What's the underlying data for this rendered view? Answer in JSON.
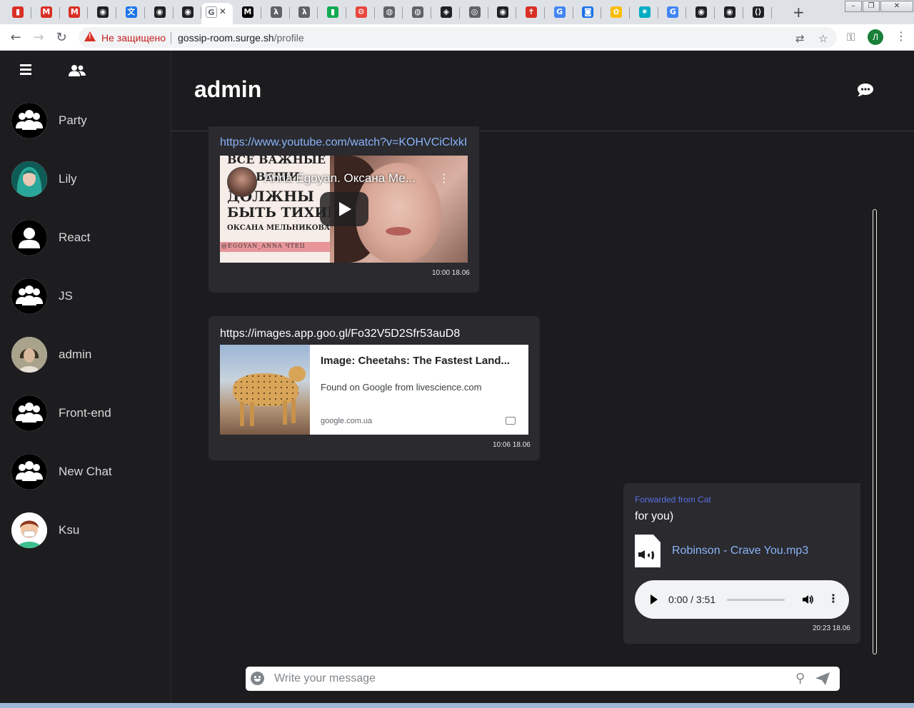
{
  "browser": {
    "tabs": [
      {
        "icon": "thermometer-icon",
        "color": "#d93025"
      },
      {
        "icon": "gmail-icon",
        "color": "#d93025"
      },
      {
        "icon": "gmail-icon",
        "color": "#d93025"
      },
      {
        "icon": "github-icon",
        "color": "#202124"
      },
      {
        "icon": "translate-icon",
        "color": "#1a73e8"
      },
      {
        "icon": "github-icon",
        "color": "#202124"
      },
      {
        "icon": "github-icon",
        "color": "#202124"
      },
      {
        "icon": "page-icon",
        "color": "#5f6368",
        "active": true
      },
      {
        "icon": "medium-icon",
        "color": "#000000"
      },
      {
        "icon": "lambda-icon",
        "color": "#5f6368"
      },
      {
        "icon": "lambda-icon",
        "color": "#5f6368"
      },
      {
        "icon": "mongodb-icon",
        "color": "#13aa52"
      },
      {
        "icon": "gear-icon",
        "color": "#e8453c"
      },
      {
        "icon": "globe-icon",
        "color": "#5f6368"
      },
      {
        "icon": "globe-icon",
        "color": "#5f6368"
      },
      {
        "icon": "cube-icon",
        "color": "#202124"
      },
      {
        "icon": "circle-icon",
        "color": "#5f6368"
      },
      {
        "icon": "github-icon",
        "color": "#202124"
      },
      {
        "icon": "figure-icon",
        "color": "#d93025"
      },
      {
        "icon": "google-icon",
        "color": "#4285f4"
      },
      {
        "icon": "app-icon",
        "color": "#1a73e8"
      },
      {
        "icon": "photos-icon",
        "color": "#fbbc04"
      },
      {
        "icon": "star-burst-icon",
        "color": "#00acc1"
      },
      {
        "icon": "google-icon",
        "color": "#4285f4"
      },
      {
        "icon": "github-icon",
        "color": "#202124"
      },
      {
        "icon": "github-icon",
        "color": "#202124"
      },
      {
        "icon": "code-icon",
        "color": "#202124"
      }
    ],
    "active_tab_letter": "G",
    "insecure_label": "Не защищено",
    "url_host": "gossip-room.surge.sh",
    "url_path": "/profile",
    "profile_initial": "Л"
  },
  "sidebar": {
    "chats": [
      {
        "name": "Party",
        "avatar": "group-icon"
      },
      {
        "name": "Lily",
        "avatar": "photo-avatar"
      },
      {
        "name": "React",
        "avatar": "user-icon"
      },
      {
        "name": "JS",
        "avatar": "group-icon"
      },
      {
        "name": "admin",
        "avatar": "photo-avatar"
      },
      {
        "name": "Front-end",
        "avatar": "group-icon"
      },
      {
        "name": "New Chat",
        "avatar": "group-icon"
      },
      {
        "name": "Ksu",
        "avatar": "cartoon-avatar"
      }
    ]
  },
  "main": {
    "title": "admin",
    "messages": [
      {
        "link": "https://www.youtube.com/watch?v=KOHVCiClxkI",
        "video_title": "Anna Egoyan. Оксана Ме...",
        "thumb_lines": [
          "ВСЕ ВАЖНЫЕ",
          "ВЕЩИ",
          "ДОЛЖНЫ",
          "БЫТЬ ТИХИМИ",
          "ОКСАНА МЕЛЬНИКОВА"
        ],
        "thumb_tag": "@EGOYAN_ANNA    ЧТЕЦ",
        "time": "10:00 18.06"
      },
      {
        "link": "https://images.app.goo.gl/Fo32V5D2Sfr53auD8",
        "preview_title": "Image: Cheetahs: The Fastest Land...",
        "preview_desc": "Found on Google from livescience.com",
        "preview_domain": "google.com.ua",
        "time": "10:06 18.06"
      },
      {
        "forwarded": "Forwarded from Cat",
        "text": "for you)",
        "file_name": "Robinson - Crave You.mp3",
        "audio_time": "0:00 / 3:51",
        "audio_progress": 0,
        "time": "20:23 18.06"
      }
    ]
  },
  "composer": {
    "placeholder": "Write your message"
  }
}
